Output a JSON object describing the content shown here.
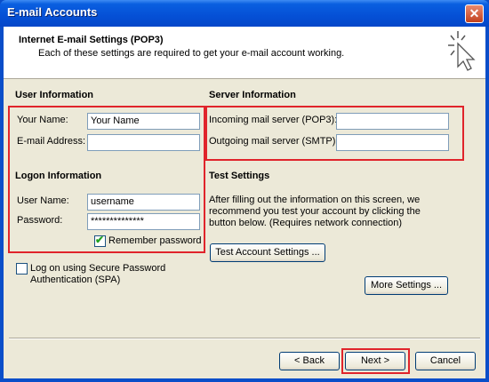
{
  "window": {
    "title": "E-mail Accounts",
    "close_label": "✕"
  },
  "header": {
    "title": "Internet E-mail Settings (POP3)",
    "subtitle": "Each of these settings are required to get your e-mail account working.",
    "icon": "wizard-cursor-icon"
  },
  "user_info": {
    "heading": "User Information",
    "name_label": "Your Name:",
    "name_value": "Your Name",
    "email_label": "E-mail Address:",
    "email_value": ""
  },
  "server_info": {
    "heading": "Server Information",
    "incoming_label": "Incoming mail server (POP3):",
    "incoming_value": "",
    "outgoing_label": "Outgoing mail server (SMTP):",
    "outgoing_value": ""
  },
  "logon_info": {
    "heading": "Logon Information",
    "username_label": "User Name:",
    "username_value": "username",
    "password_label": "Password:",
    "password_value": "**************",
    "remember_label": "Remember password",
    "remember_checked": true
  },
  "spa": {
    "label_line1": "Log on using Secure Password",
    "label_line2": "Authentication (SPA)",
    "checked": false
  },
  "test_settings": {
    "heading": "Test Settings",
    "line1": "After filling out the information on this screen, we",
    "line2": "recommend you test your account by clicking the",
    "line3": "button below. (Requires network connection)",
    "test_button": "Test Account Settings ...",
    "more_button": "More Settings ..."
  },
  "footer": {
    "back_button": "< Back",
    "next_button": "Next >",
    "cancel_button": "Cancel"
  },
  "colors": {
    "highlight": "#e0242b",
    "titlebar": "#0550d6",
    "dialog_bg": "#ece9d8"
  }
}
